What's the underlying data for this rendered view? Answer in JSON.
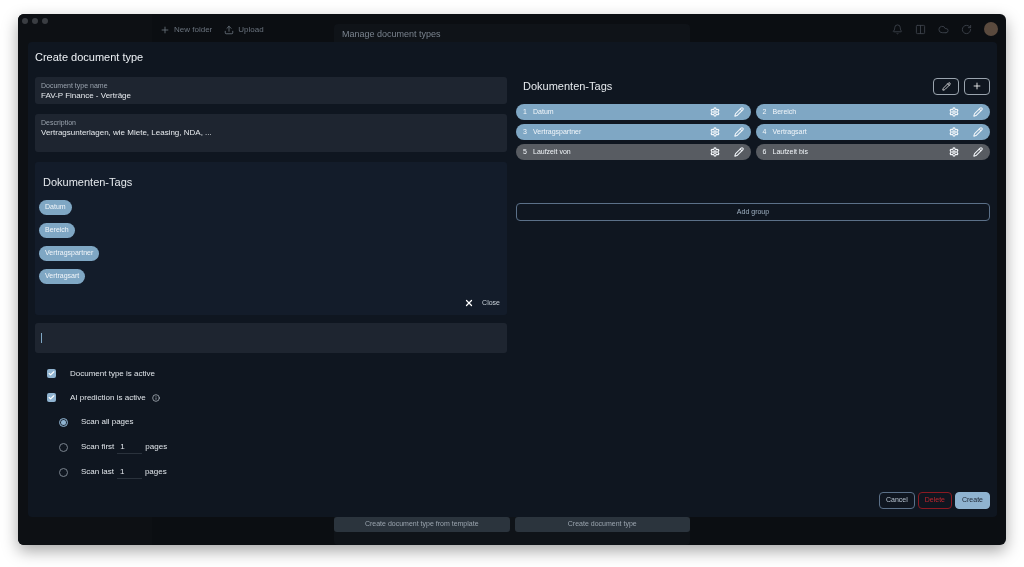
{
  "background": {
    "toolbar": [
      {
        "label": "New folder",
        "kind": "plus"
      },
      {
        "label": "Upload",
        "kind": "upload"
      }
    ],
    "panel_title": "Manage document types",
    "footer_buttons": [
      "Create document type from template",
      "Create document type"
    ]
  },
  "dialog": {
    "title": "Create document type",
    "fields": [
      {
        "label": "Document type name",
        "value": "FAV-P Finance - Verträge"
      },
      {
        "label": "Description",
        "value": "Vertragsunterlagen, wie Miete, Leasing, NDA, ..."
      }
    ],
    "tag_panel": {
      "title": "Dokumenten-Tags",
      "chips": [
        "Datum",
        "Bereich",
        "Vertragspartner",
        "Vertragsart"
      ],
      "close": "Close"
    },
    "checkboxes": [
      {
        "label": "Document type is active",
        "checked": true,
        "info": false
      },
      {
        "label": "AI prediction is active",
        "checked": true,
        "info": true
      }
    ],
    "scan_options": [
      {
        "label": "Scan all pages",
        "selected": true
      },
      {
        "label": "Scan first",
        "value": "1",
        "suffix": "pages",
        "selected": false
      },
      {
        "label": "Scan last",
        "value": "1",
        "suffix": "pages",
        "selected": false
      }
    ],
    "tags": {
      "title": "Dokumenten-Tags",
      "items": [
        {
          "number": "1",
          "label": "Datum",
          "active": true
        },
        {
          "number": "2",
          "label": "Bereich",
          "active": true
        },
        {
          "number": "3",
          "label": "Vertragspartner",
          "active": true
        },
        {
          "number": "4",
          "label": "Vertragsart",
          "active": true
        },
        {
          "number": "5",
          "label": "Laufzeit von",
          "active": false
        },
        {
          "number": "6",
          "label": "Laufzeit bis",
          "active": false
        }
      ],
      "add_group": "Add group"
    },
    "buttons": [
      {
        "label": "Cancel",
        "kind": "cancel"
      },
      {
        "label": "Delete",
        "kind": "danger"
      },
      {
        "label": "Create",
        "kind": "primary"
      }
    ]
  }
}
